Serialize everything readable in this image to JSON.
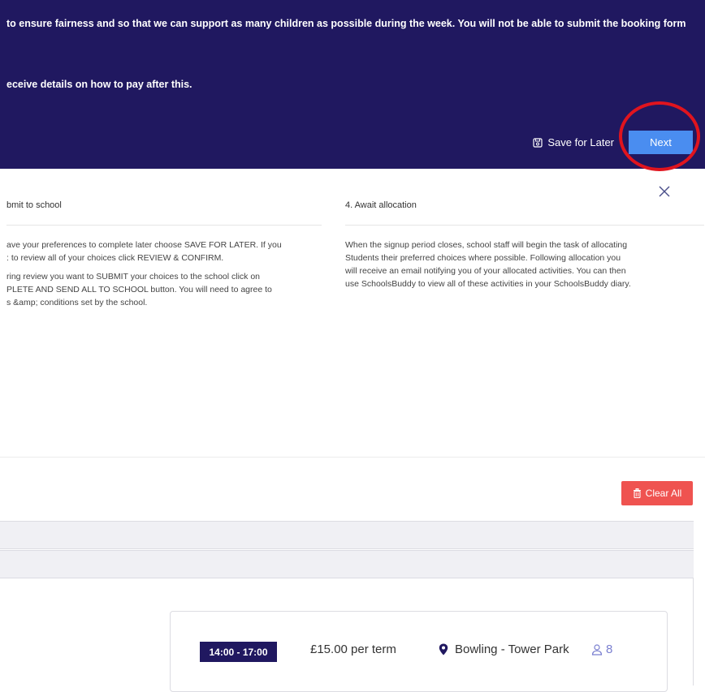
{
  "banner": {
    "line1": "to ensure fairness and so that we can support as many children as possible during the week. You will not be able to submit the booking form",
    "line2": "eceive details on how to pay after this.",
    "save_later_label": "Save for Later",
    "next_label": "Next"
  },
  "steps": {
    "left": {
      "title": "bmit to school",
      "para1_line1": "ave your preferences to complete later choose SAVE FOR LATER. If you",
      "para1_line2": ": to review all of your choices click REVIEW & CONFIRM.",
      "para2_line1": "ring review you want to SUBMIT your choices to the school click on",
      "para2_line2": "PLETE AND SEND ALL TO SCHOOL button. You will need to agree to",
      "para2_line3": "s &amp; conditions set by the school."
    },
    "right": {
      "title": "4. Await allocation",
      "para_line1": "When the signup period closes, school staff will begin the task of allocating",
      "para_line2": "Students their preferred choices where possible. Following allocation you",
      "para_line3": "will receive an email notifying you of your allocated activities. You can then",
      "para_line4": "use SchoolsBuddy to view all of these activities in your SchoolsBuddy diary."
    }
  },
  "toolbar": {
    "clear_all_label": "Clear All"
  },
  "activity": {
    "time": "14:00 - 17:00",
    "price": "£15.00 per term",
    "location": "Bowling - Tower Park",
    "capacity": "8"
  },
  "colors": {
    "banner_bg": "#201860",
    "next_button": "#4a8df0",
    "clear_all_button": "#ef5350",
    "annotation_circle": "#e0141e"
  },
  "icons": {
    "save": "floppy-disk-icon",
    "close": "close-icon",
    "trash": "trash-icon",
    "location": "map-pin-icon",
    "capacity": "person-icon"
  }
}
